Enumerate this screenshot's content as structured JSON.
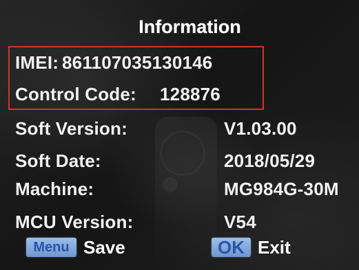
{
  "title": "Information",
  "device": {
    "imei_label": "IMEI:",
    "imei_value": "861107035130146",
    "control_code_label": "Control Code:",
    "control_code_value": "128876"
  },
  "info_rows": [
    {
      "label": "Soft Version:",
      "value": "V1.03.00"
    },
    {
      "label": "Soft Date:",
      "value": "2018/05/29"
    },
    {
      "label": "Machine:",
      "value": "MG984G-30M"
    },
    {
      "label": "MCU Version:",
      "value": "V54"
    }
  ],
  "footer": {
    "menu_key": "Menu",
    "menu_action": "Save",
    "ok_key": "OK",
    "ok_action": "Exit"
  },
  "colors": {
    "highlight_border": "#d3322f",
    "key_background": "#7fa6da",
    "key_text": "#2c55a8"
  }
}
